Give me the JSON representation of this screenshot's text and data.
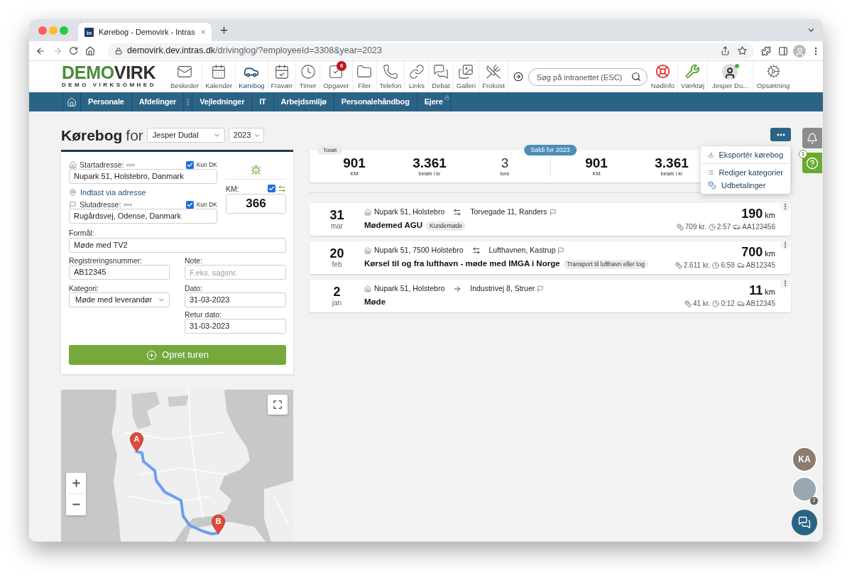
{
  "browser": {
    "favicon": "in",
    "tab_title": "Kørebog - Demovirk - Intras",
    "url_host": "demovirk.dev.intras.dk",
    "url_path": "/drivinglog/?employeeId=3308&year=2023"
  },
  "logo": {
    "primary": "DEMO",
    "secondary": "VIRK",
    "tagline": "DEMO VIRKSOMHED"
  },
  "header_nav": [
    {
      "label": "Beskeder",
      "selected": false
    },
    {
      "label": "Kalender",
      "selected": false
    },
    {
      "label": "Kørebog",
      "selected": true
    },
    {
      "label": "Fravær",
      "selected": false
    },
    {
      "label": "Timer",
      "selected": false
    },
    {
      "label": "Opgaver",
      "selected": false,
      "badge": "6"
    },
    {
      "label": "Filer",
      "selected": false
    },
    {
      "label": "Telefon",
      "selected": false
    },
    {
      "label": "Links",
      "selected": false
    },
    {
      "label": "Debat",
      "selected": false
    },
    {
      "label": "Galleri",
      "selected": false
    },
    {
      "label": "Frokost",
      "selected": false
    }
  ],
  "search": {
    "placeholder": "Søg på intranettet (ESC)"
  },
  "quick_links": [
    {
      "label": "Nødinfo"
    },
    {
      "label": "Værktøj"
    }
  ],
  "user": {
    "name": "Jesper Du...",
    "online": true
  },
  "settings": {
    "label": "Opsætning"
  },
  "menu_bar": [
    {
      "kind": "home"
    },
    {
      "kind": "link",
      "label": "Personale",
      "locked": false
    },
    {
      "kind": "link",
      "label": "Afdelinger",
      "locked": false
    },
    {
      "kind": "handle"
    },
    {
      "kind": "link",
      "label": "Vejledninger",
      "locked": false
    },
    {
      "kind": "link",
      "label": "IT",
      "locked": false
    },
    {
      "kind": "link",
      "label": "Arbejdsmiljø",
      "locked": false
    },
    {
      "kind": "link",
      "label": "Personalehåndbog",
      "locked": false
    },
    {
      "kind": "link",
      "label": "Ejere",
      "locked": true
    }
  ],
  "page": {
    "title": "Kørebog",
    "title_suffix": "for",
    "employee": "Jesper Dudal",
    "year": "2023"
  },
  "form": {
    "start_address": {
      "label": "Startadresse:",
      "value": "Nupark 51, Holstebro, Danmark",
      "only_dk": {
        "label": "Kun DK",
        "checked": true
      }
    },
    "address_link": "Indtast via adresse",
    "end_address": {
      "label": "Slutadresse:",
      "value": "Rugårdsvej, Odense, Danmark",
      "only_dk": {
        "label": "Kun DK",
        "checked": true
      }
    },
    "km": {
      "label": "KM:",
      "value": "366",
      "return_trip": {
        "checked": true
      }
    },
    "purpose": {
      "label": "Formål:",
      "value": "Møde med TV2"
    },
    "registration": {
      "label": "Registreringsnummer:",
      "value": "AB12345"
    },
    "note": {
      "label": "Note:",
      "placeholder": "F.eks. sagsnr."
    },
    "category": {
      "label": "Kategori:",
      "value": "Møde med leverandør"
    },
    "date": {
      "label": "Dato:",
      "value": "31-03-2023"
    },
    "return_date": {
      "label": "Retur dato:",
      "value": "31-03-2023"
    },
    "submit": "Opret turen"
  },
  "map": {
    "markers": [
      {
        "label": "A"
      },
      {
        "label": "B"
      }
    ]
  },
  "actions_menu": {
    "sections": [
      [
        {
          "label": "Eksportér kørebog"
        }
      ],
      [
        {
          "label": "Rediger kategorier"
        },
        {
          "label": "Udbetalinger"
        }
      ]
    ]
  },
  "summary": {
    "tab": "Totalt",
    "badge": "Saldi for 2023",
    "groups": [
      [
        {
          "value": "901",
          "label": "KM",
          "kind": "total"
        },
        {
          "value": "3.361",
          "label": "beløb i kr",
          "kind": "total"
        },
        {
          "value": "3",
          "label": "ture",
          "kind": "count"
        }
      ],
      [
        {
          "value": "901",
          "label": "KM",
          "kind": "total"
        },
        {
          "value": "3.361",
          "label": "beløb i kr",
          "kind": "total"
        }
      ]
    ]
  },
  "trips": [
    {
      "day": "31",
      "month": "mar",
      "from": "Nupark 51, Holstebro",
      "to": "Torvegade 11, Randers",
      "kind": "roundtrip",
      "title": "Mødemed AGU",
      "tag": "Kundemøde",
      "distance": "190",
      "unit": "km",
      "amount": "709 kr.",
      "duration": "2:57",
      "plate": "AA123456"
    },
    {
      "day": "20",
      "month": "feb",
      "from": "Nupark 51, 7500 Holstebro",
      "to": "Lufthavnen, Kastrup",
      "kind": "roundtrip",
      "title": "Kørsel til og fra lufthavn - møde med IMGA i Norge",
      "tag": "Transport til lufthavn eller tog",
      "distance": "700",
      "unit": "km",
      "amount": "2.611 kr.",
      "duration": "6:59",
      "plate": "AB12345"
    },
    {
      "day": "2",
      "month": "jan",
      "from": "Nupark 51, Holstebro",
      "to": "Industrivej 8, Struer",
      "kind": "oneway",
      "title": "Møde",
      "distance": "11",
      "unit": "km",
      "amount": "41 kr.",
      "duration": "0:12",
      "plate": "AB12345"
    }
  ],
  "side_panel": {
    "help_count": "1"
  },
  "chat": {
    "contacts": [
      {
        "kind": "initials",
        "initials": "KA"
      },
      {
        "kind": "photo",
        "count": "2"
      }
    ]
  }
}
